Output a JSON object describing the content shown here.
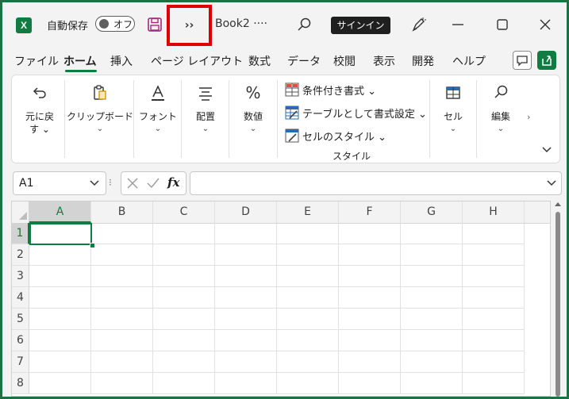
{
  "titlebar": {
    "app_logo_letter": "X",
    "autosave_label": "自動保存",
    "autosave_state": "オフ",
    "more_commands": "››",
    "book_title": "Book2  ····",
    "signin_label": "サインイン",
    "highlight_color": "#e00000"
  },
  "tabs": [
    {
      "label": "ファイル",
      "active": false
    },
    {
      "label": "ホーム",
      "active": true
    },
    {
      "label": "挿入",
      "active": false
    },
    {
      "label": "ページ レイアウト",
      "active": false
    },
    {
      "label": "数式",
      "active": false
    },
    {
      "label": "データ",
      "active": false
    },
    {
      "label": "校閲",
      "active": false
    },
    {
      "label": "表示",
      "active": false
    },
    {
      "label": "開発",
      "active": false
    },
    {
      "label": "ヘルプ",
      "active": false
    }
  ],
  "ribbon": {
    "undo": {
      "line1": "元に戻",
      "line2": "す ⌄"
    },
    "clipboard": "クリップボード",
    "font": "フォント",
    "alignment": "配置",
    "number": "数値",
    "conditional_format": "条件付き書式 ⌄",
    "format_as_table": "テーブルとして書式設定 ⌄",
    "cell_styles": "セルのスタイル ⌄",
    "styles_group": "スタイル",
    "cells": "セル",
    "editing": "編集",
    "scroll_right": "›"
  },
  "formula_bar": {
    "name_box": "A1",
    "dots": "⁝",
    "fx": "fx",
    "formula": ""
  },
  "grid": {
    "columns": [
      "A",
      "B",
      "C",
      "D",
      "E",
      "F",
      "G",
      "H"
    ],
    "rows": [
      "1",
      "2",
      "3",
      "4",
      "5",
      "6",
      "7",
      "8"
    ],
    "active_cell": "A1"
  },
  "colors": {
    "brand": "#107c41",
    "frame": "#1e7145"
  }
}
